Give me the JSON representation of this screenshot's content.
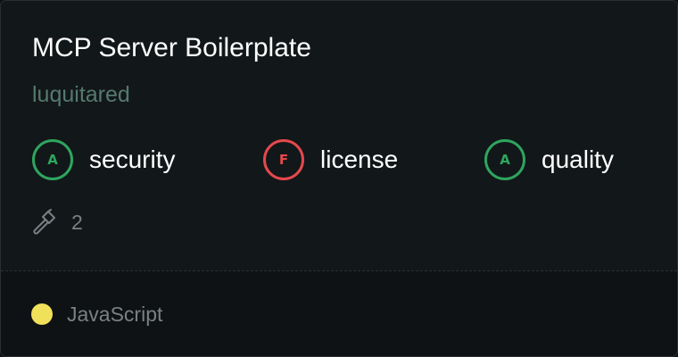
{
  "card": {
    "title": "MCP Server Boilerplate",
    "author": "luquitared"
  },
  "scores": [
    {
      "grade": "A",
      "label": "security",
      "status": "pass"
    },
    {
      "grade": "F",
      "label": "license",
      "status": "fail"
    },
    {
      "grade": "A",
      "label": "quality",
      "status": "pass"
    }
  ],
  "tools": {
    "icon": "hammer-icon",
    "count": "2"
  },
  "language": {
    "name": "JavaScript",
    "color": "#f1e05a"
  },
  "colors": {
    "pass": "#2ea55e",
    "fail": "#e5484d",
    "author": "#557a6d"
  }
}
